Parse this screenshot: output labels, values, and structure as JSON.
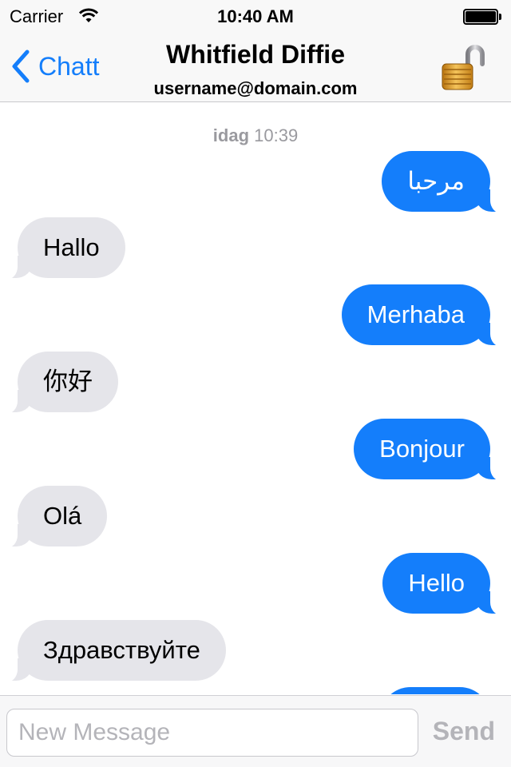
{
  "status_bar": {
    "carrier": "Carrier",
    "time": "10:40 AM",
    "wifi_icon": "wifi-icon",
    "battery_icon": "battery-icon"
  },
  "nav": {
    "back_label": "Chatt",
    "back_icon": "chevron-left-icon",
    "title": "Whitfield Diffie",
    "subtitle": "username@domain.com",
    "lock_icon": "open-padlock-icon"
  },
  "chat": {
    "timestamp_day": "idag",
    "timestamp_time": "10:39",
    "messages": [
      {
        "direction": "outgoing",
        "text": "مرحبا"
      },
      {
        "direction": "incoming",
        "text": "Hallo"
      },
      {
        "direction": "outgoing",
        "text": "Merhaba"
      },
      {
        "direction": "incoming",
        "text": "你好"
      },
      {
        "direction": "outgoing",
        "text": "Bonjour"
      },
      {
        "direction": "incoming",
        "text": "Olá"
      },
      {
        "direction": "outgoing",
        "text": "Hello"
      },
      {
        "direction": "incoming",
        "text": "Здравствуйте"
      },
      {
        "direction": "outgoing",
        "text": ""
      }
    ]
  },
  "composer": {
    "placeholder": "New Message",
    "value": "",
    "send_label": "Send"
  },
  "colors": {
    "accent": "#147efb",
    "incoming_bubble": "#e5e5ea",
    "outgoing_bubble": "#147efb",
    "muted_text": "#9a9a9f"
  }
}
